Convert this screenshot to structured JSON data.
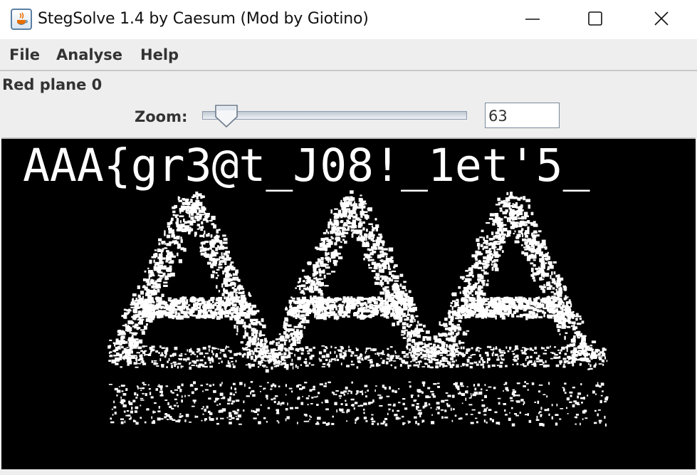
{
  "window": {
    "title": "StegSolve 1.4 by Caesum (Mod by Giotino)"
  },
  "menu": {
    "items": [
      "File",
      "Analyse",
      "Help"
    ]
  },
  "header": {
    "plane_label": "Red plane 0",
    "zoom_label": "Zoom:",
    "zoom_value": "63",
    "zoom_slider_fraction": 0.05
  },
  "image": {
    "visible_text": "AAA{gr3@t_J08!_1et'5_",
    "shown_letters": [
      "A",
      "A",
      "A"
    ],
    "colors": {
      "background": "#000000",
      "foreground": "#ffffff"
    }
  },
  "icons": {
    "app": "java-icon",
    "minimize": "minimize-icon",
    "maximize": "maximize-icon",
    "close": "close-icon"
  }
}
